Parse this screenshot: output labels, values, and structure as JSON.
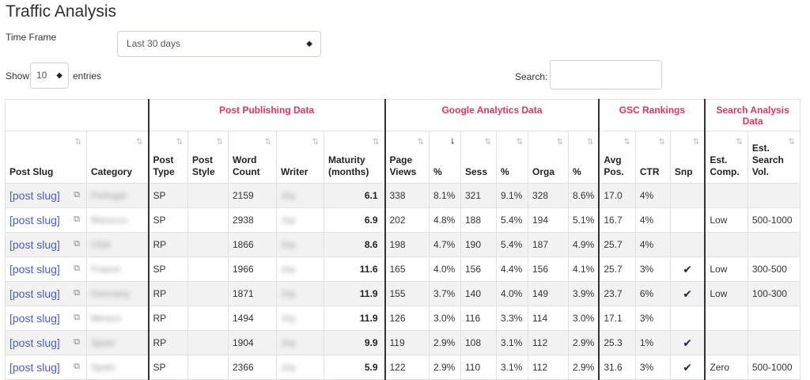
{
  "title": "Traffic Analysis",
  "time_frame": {
    "label": "Time Frame",
    "value": "Last 30 days"
  },
  "entries": {
    "show_label": "Show",
    "value": "10",
    "suffix": "entries"
  },
  "search": {
    "label": "Search:",
    "value": ""
  },
  "groups": {
    "post_publishing": "Post Publishing Data",
    "google_analytics": "Google Analytics Data",
    "gsc": "GSC Rankings",
    "search_analysis": "Search Analysis Data"
  },
  "columns": {
    "post_slug": "Post Slug",
    "category": "Category",
    "post_type": "Post Type",
    "post_style": "Post Style",
    "word_count": "Word Count",
    "writer": "Writer",
    "maturity": "Maturity (months)",
    "page_views": "Page Views",
    "pv_pct": "%",
    "sess": "Sess",
    "sess_pct": "%",
    "orga": "Orga",
    "orga_pct": "%",
    "avg_pos": "Avg Pos.",
    "ctr": "CTR",
    "snp": "Snp",
    "est_comp": "Est. Comp.",
    "est_vol": "Est. Search Vol."
  },
  "rows": [
    {
      "slug": "[post slug]",
      "category": "Portugal",
      "type": "SP",
      "style": "",
      "words": "2159",
      "writer": "Joy",
      "maturity": "6.1",
      "pv": "338",
      "pv_pct": "8.1%",
      "sess": "321",
      "sess_pct": "9.1%",
      "orga": "328",
      "orga_pct": "8.6%",
      "avg_pos": "17.0",
      "ctr": "4%",
      "snp": "",
      "comp": "",
      "vol": ""
    },
    {
      "slug": "[post slug]",
      "category": "Morocco",
      "type": "SP",
      "style": "",
      "words": "2938",
      "writer": "Joy",
      "maturity": "6.9",
      "pv": "202",
      "pv_pct": "4.8%",
      "sess": "188",
      "sess_pct": "5.4%",
      "orga": "194",
      "orga_pct": "5.1%",
      "avg_pos": "16.7",
      "ctr": "4%",
      "snp": "",
      "comp": "Low",
      "vol": "500-1000"
    },
    {
      "slug": "[post slug]",
      "category": "USA",
      "type": "RP",
      "style": "",
      "words": "1866",
      "writer": "Joy",
      "maturity": "8.6",
      "pv": "198",
      "pv_pct": "4.7%",
      "sess": "190",
      "sess_pct": "5.4%",
      "orga": "187",
      "orga_pct": "4.9%",
      "avg_pos": "25.7",
      "ctr": "4%",
      "snp": "",
      "comp": "",
      "vol": ""
    },
    {
      "slug": "[post slug]",
      "category": "France",
      "type": "SP",
      "style": "",
      "words": "1966",
      "writer": "Joy",
      "maturity": "11.6",
      "pv": "165",
      "pv_pct": "4.0%",
      "sess": "156",
      "sess_pct": "4.4%",
      "orga": "156",
      "orga_pct": "4.1%",
      "avg_pos": "25.7",
      "ctr": "3%",
      "snp": "✔",
      "comp": "Low",
      "vol": "300-500"
    },
    {
      "slug": "[post slug]",
      "category": "Germany",
      "type": "RP",
      "style": "",
      "words": "1871",
      "writer": "Joy",
      "maturity": "11.9",
      "pv": "155",
      "pv_pct": "3.7%",
      "sess": "140",
      "sess_pct": "4.0%",
      "orga": "149",
      "orga_pct": "3.9%",
      "avg_pos": "23.7",
      "ctr": "6%",
      "snp": "✔",
      "comp": "Low",
      "vol": "100-300"
    },
    {
      "slug": "[post slug]",
      "category": "Mexico",
      "type": "RP",
      "style": "",
      "words": "1494",
      "writer": "Joy",
      "maturity": "11.9",
      "pv": "126",
      "pv_pct": "3.0%",
      "sess": "116",
      "sess_pct": "3.3%",
      "orga": "114",
      "orga_pct": "3.0%",
      "avg_pos": "17.1",
      "ctr": "3%",
      "snp": "",
      "comp": "",
      "vol": ""
    },
    {
      "slug": "[post slug]",
      "category": "Spain",
      "type": "RP",
      "style": "",
      "words": "1904",
      "writer": "Joy",
      "maturity": "9.9",
      "pv": "119",
      "pv_pct": "2.9%",
      "sess": "108",
      "sess_pct": "3.1%",
      "orga": "112",
      "orga_pct": "2.9%",
      "avg_pos": "25.3",
      "ctr": "1%",
      "snp": "✔",
      "comp": "",
      "vol": ""
    },
    {
      "slug": "[post slug]",
      "category": "Spain",
      "type": "SP",
      "style": "",
      "words": "2366",
      "writer": "Joy",
      "maturity": "5.9",
      "pv": "122",
      "pv_pct": "2.9%",
      "sess": "110",
      "sess_pct": "3.1%",
      "orga": "112",
      "orga_pct": "2.9%",
      "avg_pos": "31.6",
      "ctr": "3%",
      "snp": "✔",
      "comp": "Zero",
      "vol": "500-1000"
    }
  ],
  "icons": {
    "external_link": "external-link-icon",
    "sort": "sort-icon",
    "check": "check-icon"
  }
}
